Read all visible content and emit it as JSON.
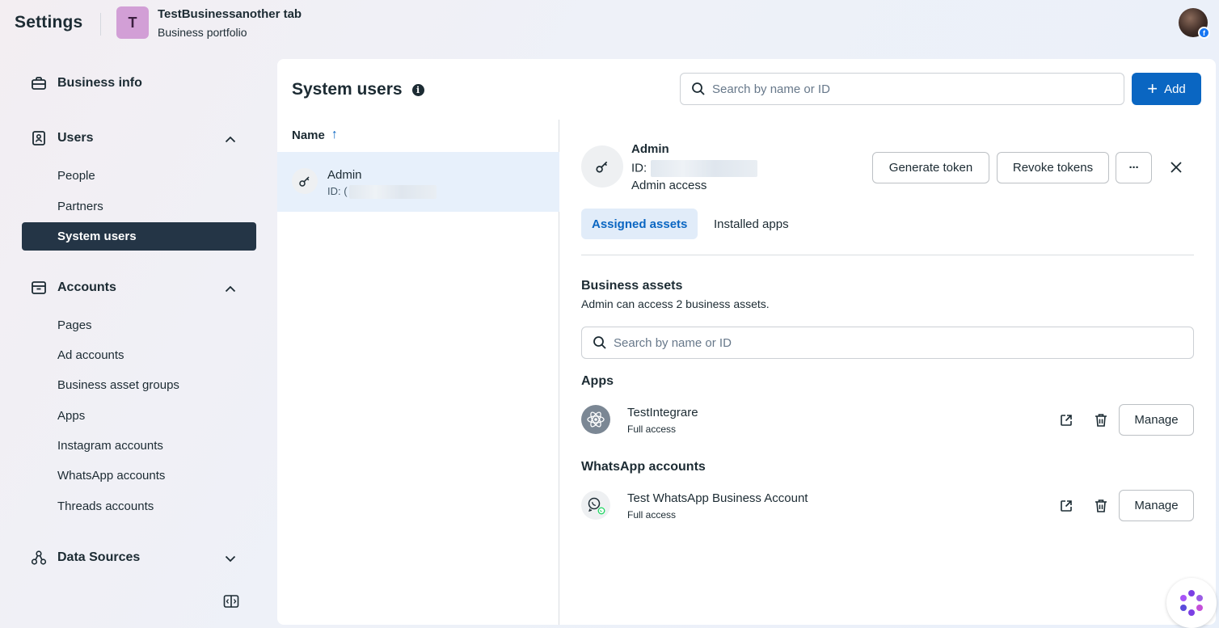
{
  "header": {
    "title": "Settings",
    "business_initial": "T",
    "business_name": "TestBusinessanother tab",
    "business_sub": "Business portfolio"
  },
  "sidebar": {
    "business_info": "Business info",
    "users": {
      "label": "Users",
      "items": [
        "People",
        "Partners",
        "System users"
      ],
      "active": "System users"
    },
    "accounts": {
      "label": "Accounts",
      "items": [
        "Pages",
        "Ad accounts",
        "Business asset groups",
        "Apps",
        "Instagram accounts",
        "WhatsApp accounts",
        "Threads accounts"
      ]
    },
    "data_sources": "Data Sources"
  },
  "main": {
    "title": "System users",
    "search_placeholder": "Search by name or ID",
    "add_label": "Add",
    "list": {
      "column": "Name",
      "sort_arrow": "↑",
      "rows": [
        {
          "name": "Admin",
          "id_prefix": "ID: ("
        }
      ]
    },
    "detail": {
      "name": "Admin",
      "id_label": "ID:",
      "role": "Admin access",
      "buttons": {
        "generate": "Generate token",
        "revoke": "Revoke tokens",
        "more": "···"
      },
      "tabs": [
        "Assigned assets",
        "Installed apps"
      ],
      "active_tab": "Assigned assets",
      "business_assets": {
        "title": "Business assets",
        "subtitle": "Admin can access 2 business assets.",
        "search_placeholder": "Search by name or ID"
      },
      "apps": {
        "title": "Apps",
        "items": [
          {
            "name": "TestIntegrare",
            "access": "Full access",
            "manage": "Manage"
          }
        ]
      },
      "whatsapp": {
        "title": "WhatsApp accounts",
        "items": [
          {
            "name": "Test WhatsApp Business Account",
            "access": "Full access",
            "manage": "Manage"
          }
        ]
      }
    }
  },
  "colors": {
    "primary": "#0a66c2",
    "active_nav": "#243546",
    "business_avatar": "#d29fd6",
    "text": "#1c2b33",
    "whatsapp": "#25d366"
  }
}
